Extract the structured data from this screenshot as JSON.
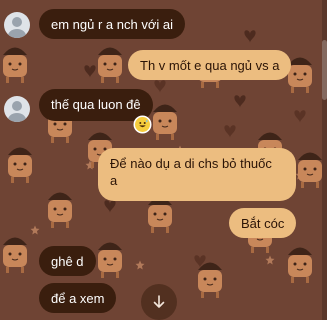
{
  "conversation": {
    "messages": [
      {
        "side": "left",
        "text": "em ngủ r a nch với ai",
        "avatar": "user-avatar-icon"
      },
      {
        "side": "right",
        "text": "Th v mốt e qua ngủ vs a"
      },
      {
        "side": "left",
        "text": "thế qua luon đê",
        "avatar": "user-avatar-icon",
        "reaction": "grinning-sweat-emoji"
      },
      {
        "side": "right",
        "lines": [
          "Để nào dụ a di chs bỏ thuốc",
          "a"
        ]
      },
      {
        "side": "right",
        "text": "Bắt cóc"
      },
      {
        "side": "left",
        "text": "ghê d"
      },
      {
        "side": "left",
        "text": "để a xem"
      }
    ]
  },
  "controls": {
    "scroll_down_icon": "arrow-down-icon"
  },
  "colors": {
    "wallpaper": "#6f4434",
    "incoming_bubble": "#3a1e0e",
    "outgoing_bubble": "#ecbd80",
    "outgoing_text": "#2b1406",
    "incoming_text": "#ffffff"
  }
}
